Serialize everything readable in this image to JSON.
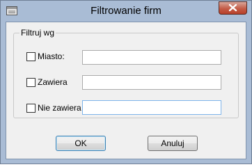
{
  "window": {
    "title": "Filtrowanie firm",
    "icon": "window-app-icon",
    "close_icon": "close-icon"
  },
  "group": {
    "legend": "Filtruj wg",
    "rows": [
      {
        "label": "Miasto:",
        "checked": false,
        "value": ""
      },
      {
        "label": "Zawiera",
        "checked": false,
        "value": ""
      },
      {
        "label": "Nie zawiera",
        "checked": false,
        "value": ""
      }
    ]
  },
  "buttons": {
    "ok": "OK",
    "cancel": "Anuluj"
  }
}
